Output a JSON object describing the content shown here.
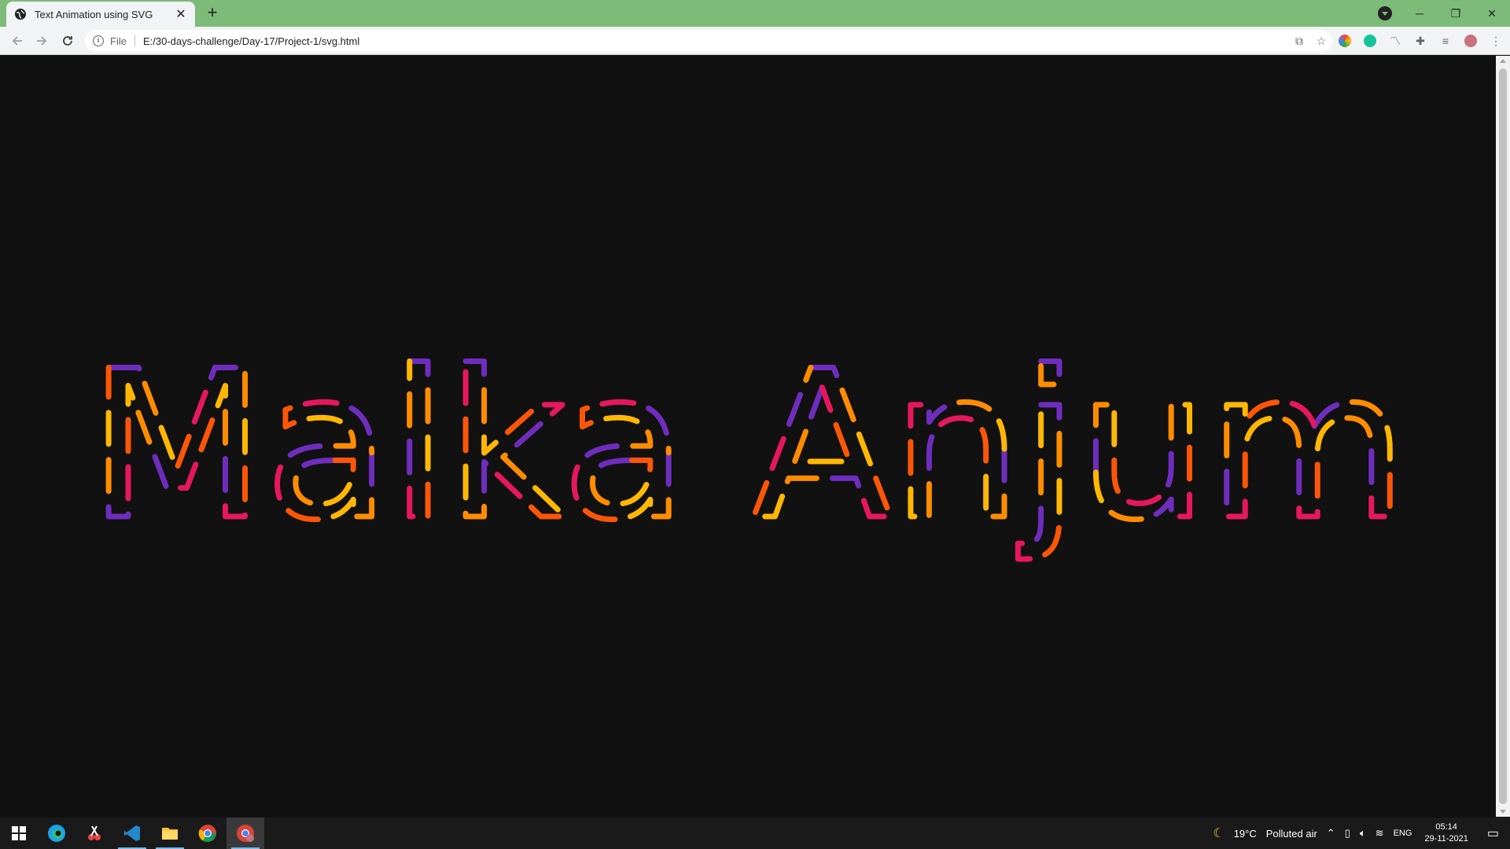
{
  "browser": {
    "tab": {
      "title": "Text Animation using SVG",
      "favicon": "globe-icon",
      "close_glyph": "✕"
    },
    "new_tab_glyph": "+",
    "window_controls": {
      "minimize": "─",
      "restore": "❐",
      "close": "✕"
    },
    "omnibox": {
      "scheme_label": "File",
      "url": "E:/30-days-challenge/Day-17/Project-1/svg.html"
    }
  },
  "page": {
    "svg_text": "Malka Anjum",
    "stroke_colors": [
      "#ffb703",
      "#fb5607",
      "#e6185d",
      "#6f2dbd",
      "#ff8c00"
    ],
    "background": "#111111"
  },
  "taskbar": {
    "weather": {
      "temp": "19°C",
      "condition": "Polluted air"
    },
    "language": "ENG",
    "time": "05:14",
    "date": "29-11-2021"
  }
}
